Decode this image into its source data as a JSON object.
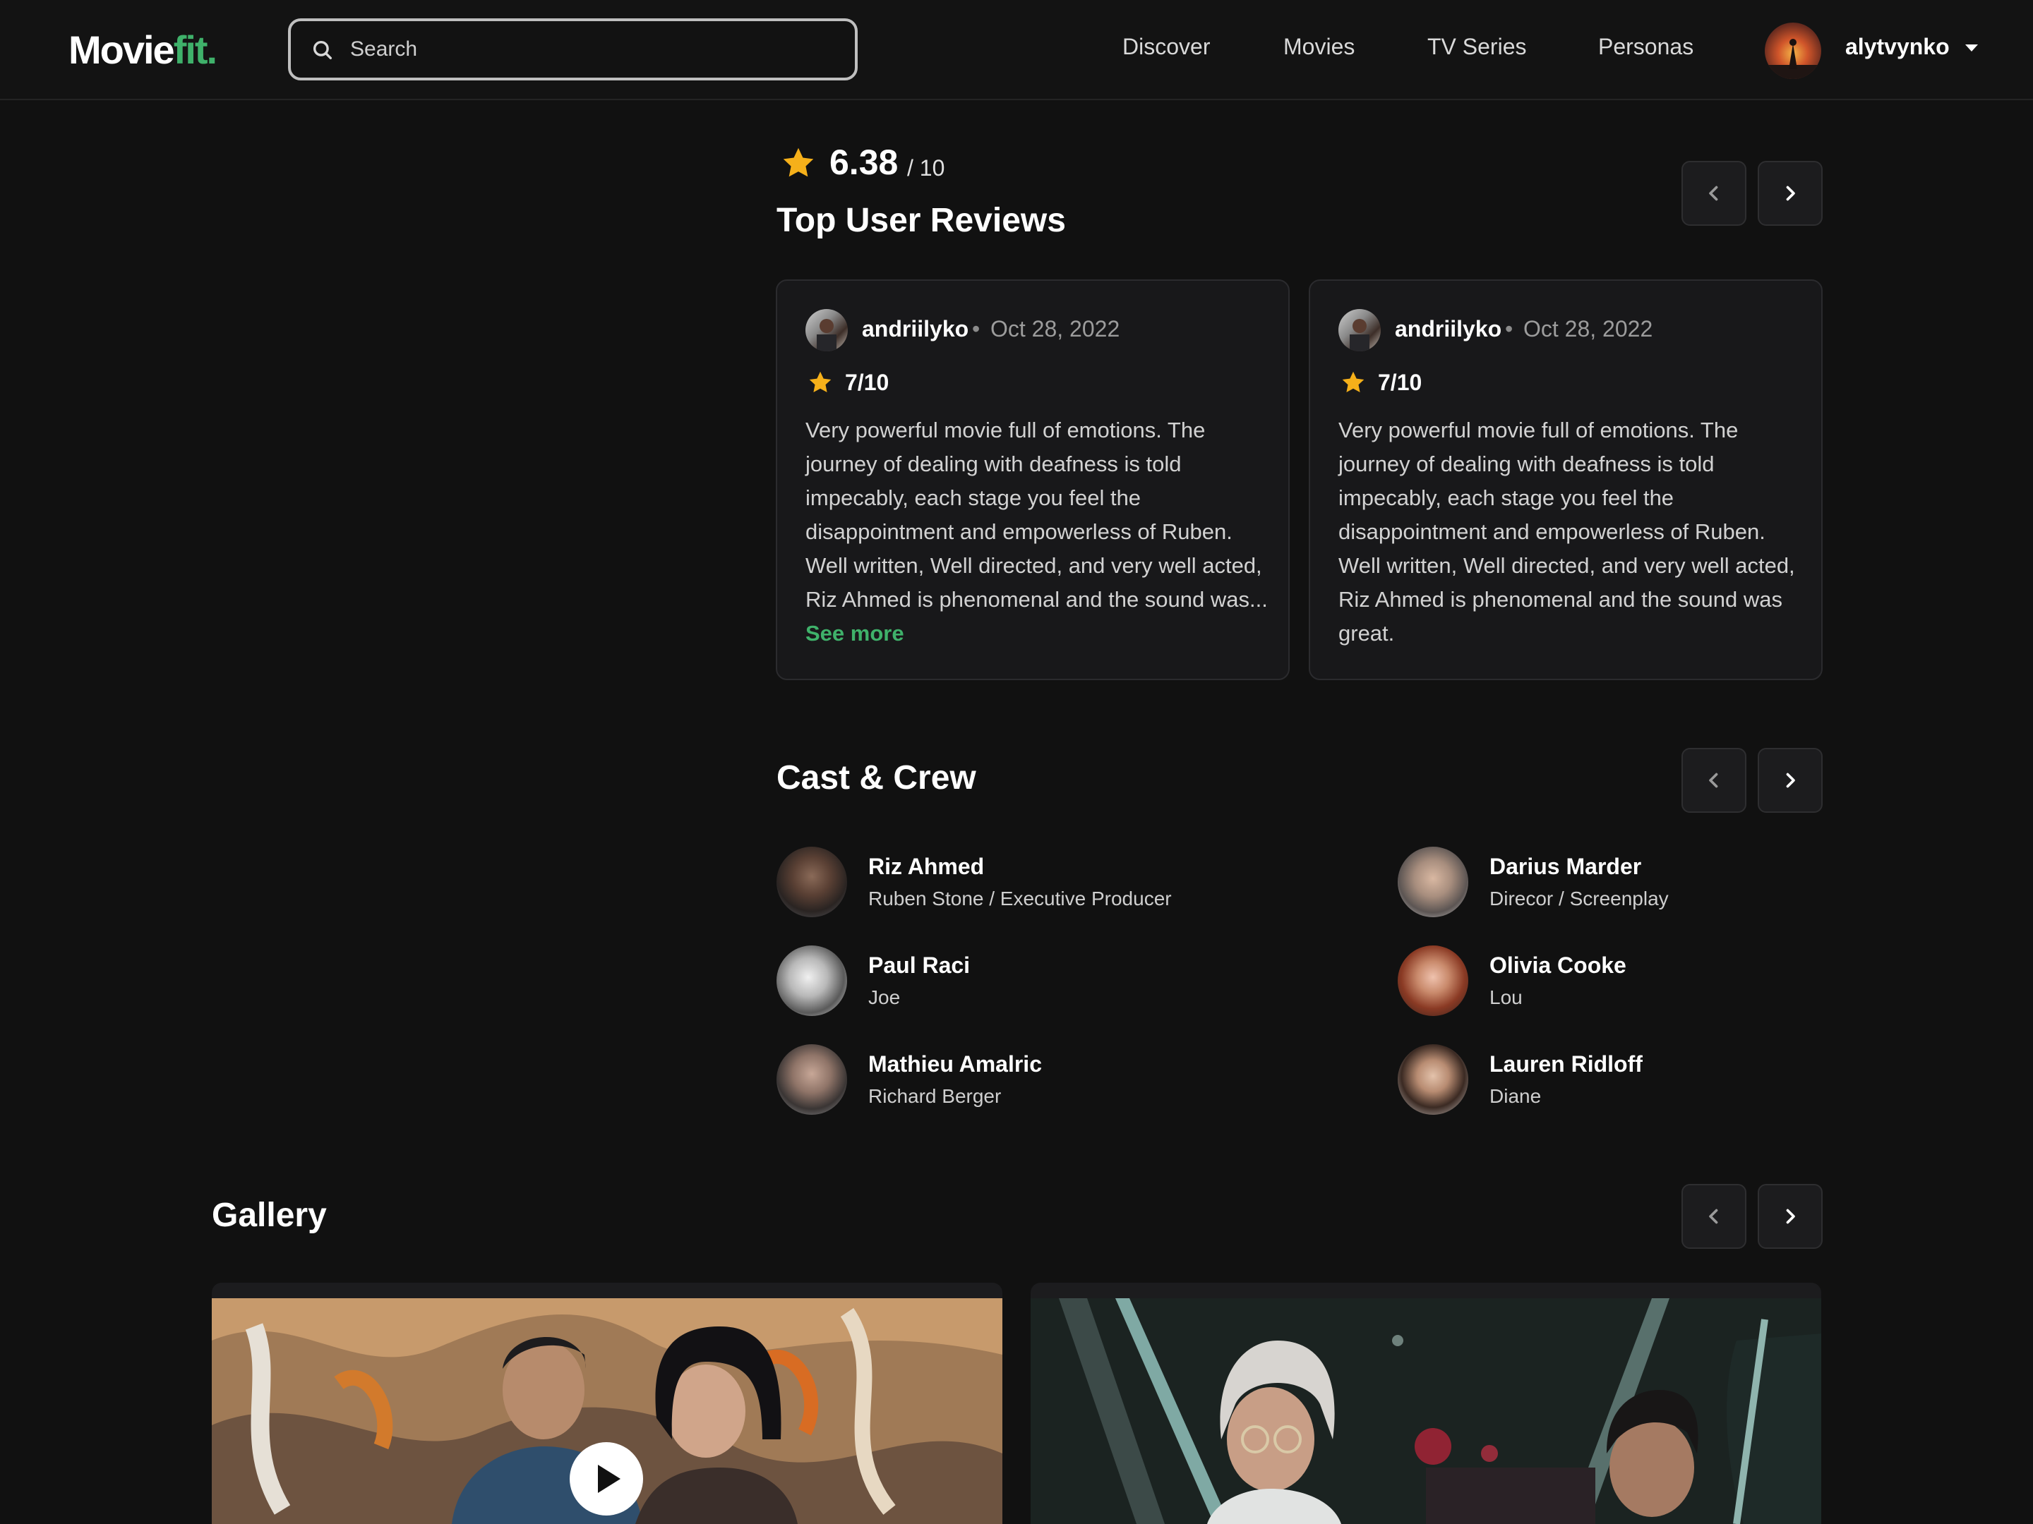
{
  "nav": {
    "logo_part1": "Movie",
    "logo_part2": "fit.",
    "search_placeholder": "Search",
    "links": [
      "Discover",
      "Movies",
      "TV Series",
      "Personas"
    ],
    "username": "alytvynko",
    "accent_color": "#3fb16a"
  },
  "rating": {
    "value": "6.38",
    "max": "/ 10"
  },
  "reviews": {
    "title": "Top User Reviews",
    "items": [
      {
        "author": "andriilyko",
        "date": "Oct 28, 2022",
        "score": "7/10",
        "text": "Very powerful movie full of emotions. The journey of dealing with deafness is told impecably, each stage you feel the disappointment and empowerless of Ruben. Well written, Well directed, and very well acted, Riz Ahmed is phenomenal and the sound was...",
        "see_more": "See more"
      },
      {
        "author": "andriilyko",
        "date": "Oct 28, 2022",
        "score": "7/10",
        "text": "Very powerful movie full of emotions. The journey of dealing with deafness is told impecably, each stage you feel the disappointment and empowerless of Ruben. Well written, Well directed, and very well acted, Riz Ahmed is phenomenal and the sound was great.",
        "see_more": ""
      }
    ]
  },
  "cast": {
    "title": "Cast & Crew",
    "people": [
      {
        "name": "Riz Ahmed",
        "role": "Ruben Stone / Executive Producer"
      },
      {
        "name": "Darius Marder",
        "role": "Direcor / Screenplay"
      },
      {
        "name": "Paul Raci",
        "role": "Joe"
      },
      {
        "name": "Olivia Cooke",
        "role": "Lou"
      },
      {
        "name": "Mathieu Amalric",
        "role": "Richard Berger"
      },
      {
        "name": "Lauren Ridloff",
        "role": "Diane"
      }
    ]
  },
  "gallery": {
    "title": "Gallery"
  },
  "icons": {
    "search": "search-icon",
    "star": "star-icon",
    "prev": "chevron-left-icon",
    "next": "chevron-right-icon",
    "caret": "caret-down-icon",
    "play": "play-icon"
  },
  "colors": {
    "background": "#111111",
    "card": "#18181a",
    "star": "#f5b01a",
    "accent": "#3fb16a"
  }
}
